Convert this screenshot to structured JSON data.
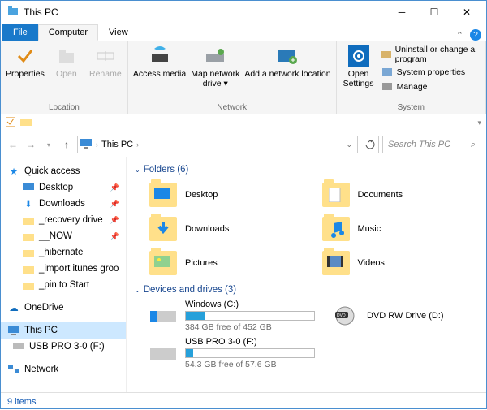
{
  "window": {
    "title": "This PC"
  },
  "tabs": {
    "file": "File",
    "computer": "Computer",
    "view": "View"
  },
  "ribbon": {
    "location": {
      "label": "Location",
      "properties": "Properties",
      "open": "Open",
      "rename": "Rename"
    },
    "network": {
      "label": "Network",
      "access_media": "Access media",
      "map_drive": "Map network drive",
      "add_location": "Add a network location"
    },
    "system": {
      "label": "System",
      "open_settings": "Open Settings",
      "uninstall": "Uninstall or change a program",
      "sys_props": "System properties",
      "manage": "Manage"
    }
  },
  "address": {
    "location": "This PC",
    "search_placeholder": "Search This PC"
  },
  "nav": {
    "quick_access": "Quick access",
    "items": [
      "Desktop",
      "Downloads",
      "_recovery drive",
      "__NOW",
      "_hibernate",
      "_import itunes groo",
      "_pin to Start"
    ],
    "onedrive": "OneDrive",
    "this_pc": "This PC",
    "usb": "USB PRO 3-0 (F:)",
    "network": "Network"
  },
  "content": {
    "folders_header": "Folders (6)",
    "folders": [
      "Desktop",
      "Documents",
      "Downloads",
      "Music",
      "Pictures",
      "Videos"
    ],
    "drives_header": "Devices and drives (3)",
    "drives": [
      {
        "name": "Windows (C:)",
        "free_text": "384 GB free of 452 GB",
        "used_pct": 15
      },
      {
        "name": "DVD RW Drive (D:)"
      },
      {
        "name": "USB PRO 3-0 (F:)",
        "free_text": "54.3 GB free of 57.6 GB",
        "used_pct": 6
      }
    ]
  },
  "status": {
    "text": "9 items"
  }
}
